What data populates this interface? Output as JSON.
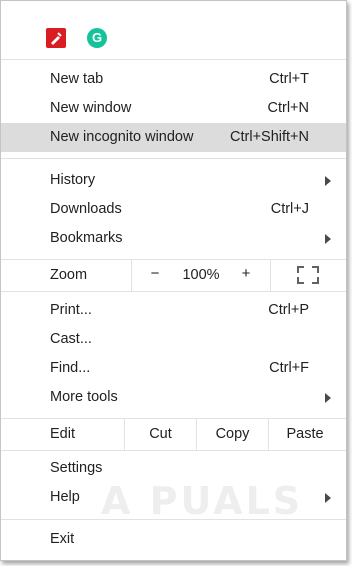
{
  "extensions": [
    {
      "name": "pen-extension-icon",
      "color": "#d81e23"
    },
    {
      "name": "grammarly-icon",
      "letter": "G",
      "color": "#15c39a"
    }
  ],
  "group1": [
    {
      "label": "New tab",
      "shortcut": "Ctrl+T"
    },
    {
      "label": "New window",
      "shortcut": "Ctrl+N"
    },
    {
      "label": "New incognito window",
      "shortcut": "Ctrl+Shift+N",
      "highlighted": true
    }
  ],
  "group2": [
    {
      "label": "History",
      "submenu": true
    },
    {
      "label": "Downloads",
      "shortcut": "Ctrl+J"
    },
    {
      "label": "Bookmarks",
      "submenu": true
    }
  ],
  "zoom": {
    "label": "Zoom",
    "minus": "−",
    "value": "100%",
    "plus": "+",
    "fullscreen_icon": "fullscreen-icon"
  },
  "group3": [
    {
      "label": "Print...",
      "shortcut": "Ctrl+P"
    },
    {
      "label": "Cast..."
    },
    {
      "label": "Find...",
      "shortcut": "Ctrl+F"
    },
    {
      "label": "More tools",
      "submenu": true
    }
  ],
  "edit": {
    "label": "Edit",
    "cut": "Cut",
    "copy": "Copy",
    "paste": "Paste"
  },
  "group4": [
    {
      "label": "Settings"
    },
    {
      "label": "Help",
      "submenu": true
    }
  ],
  "exit": {
    "label": "Exit"
  },
  "watermark": "A PUALS"
}
